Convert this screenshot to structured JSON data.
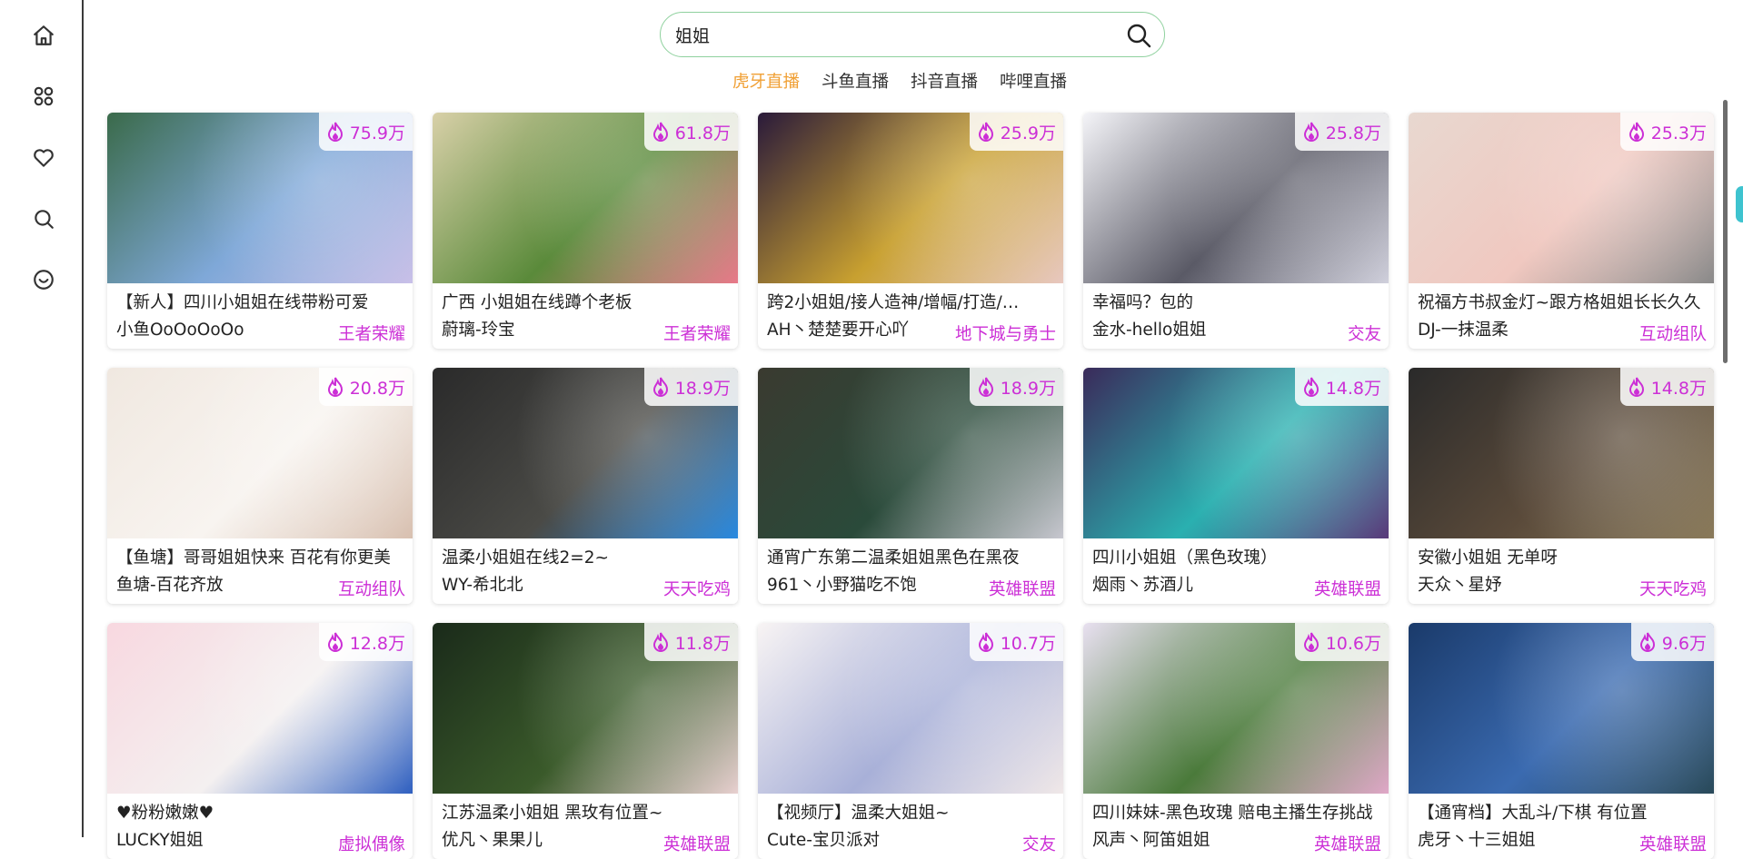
{
  "sidebar": {
    "items": [
      {
        "name": "home-icon"
      },
      {
        "name": "category-icon"
      },
      {
        "name": "heart-icon"
      },
      {
        "name": "search-icon"
      },
      {
        "name": "smile-icon"
      }
    ]
  },
  "search": {
    "value": "姐姐",
    "placeholder": ""
  },
  "tabs": [
    "虎牙直播",
    "斗鱼直播",
    "抖音直播",
    "哔哩直播"
  ],
  "active_tab": 0,
  "colors": {
    "accent": "#f0a035",
    "badge": "#cc2fd6",
    "search_border": "#8fd19e"
  },
  "rooms": [
    {
      "heat": "75.9万",
      "category": "王者荣耀",
      "title": "【新人】四川小姐姐在线带粉可爱",
      "anchor": "小鱼OoOoOoOo",
      "colors": [
        "#3a6a4a",
        "#7fa8d8",
        "#c9c0e8"
      ]
    },
    {
      "heat": "61.8万",
      "category": "王者荣耀",
      "title": "广西 小姐姐在线蹲个老板",
      "anchor": "蔚璃-玲宝",
      "colors": [
        "#d8d0a8",
        "#5a8a3a",
        "#e87a8a"
      ]
    },
    {
      "heat": "25.9万",
      "category": "地下城与勇士",
      "title": "跨2小姐姐/接人造神/增幅/打造/…",
      "anchor": "AH丶楚楚要开心吖",
      "colors": [
        "#2a1a3a",
        "#c8a030",
        "#e8c8c0"
      ]
    },
    {
      "heat": "25.8万",
      "category": "交友",
      "title": "幸福吗？包的",
      "anchor": "金水-hello姐姐",
      "colors": [
        "#f4f4f8",
        "#5a5a66",
        "#d0d0dc"
      ]
    },
    {
      "heat": "25.3万",
      "category": "互动组队",
      "title": "祝福方书叔金灯~跟方格姐姐长长久久",
      "anchor": "DJ-一抹温柔",
      "colors": [
        "#e8d8d0",
        "#f0c8c0",
        "#8a8a8a"
      ]
    },
    {
      "heat": "20.8万",
      "category": "互动组队",
      "title": "【鱼塘】哥哥姐姐快来 百花有你更美",
      "anchor": "鱼塘-百花齐放",
      "colors": [
        "#f0e8e0",
        "#f8f4f0",
        "#d8c0b0"
      ]
    },
    {
      "heat": "18.9万",
      "category": "天天吃鸡",
      "title": "温柔小姐姐在线2=2~",
      "anchor": "WY-希北北",
      "colors": [
        "#2a2a2a",
        "#4a4a46",
        "#2a8ae0"
      ]
    },
    {
      "heat": "18.9万",
      "category": "英雄联盟",
      "title": "通宵广东第二温柔姐姐黑色在黑夜",
      "anchor": "961丶小野猫吃不饱",
      "colors": [
        "#3a3a30",
        "#2a4a3a",
        "#c8c8d0"
      ]
    },
    {
      "heat": "14.8万",
      "category": "英雄联盟",
      "title": "四川小姐姐（黑色玫瑰）",
      "anchor": "烟雨丶苏酒儿",
      "colors": [
        "#3a2a5a",
        "#2ab0b0",
        "#5a3a7a"
      ]
    },
    {
      "heat": "14.8万",
      "category": "天天吃鸡",
      "title": "安徽小姐姐 无单呀",
      "anchor": "天众丶星妤",
      "colors": [
        "#2a2a2a",
        "#5a4a3a",
        "#8a7a5a"
      ]
    },
    {
      "heat": "12.8万",
      "category": "虚拟偶像",
      "title": "♥粉粉嫩嫩♥",
      "anchor": "LUCKY姐姐",
      "colors": [
        "#f8d8e0",
        "#f4f0f0",
        "#3060c0"
      ]
    },
    {
      "heat": "11.8万",
      "category": "英雄联盟",
      "title": "江苏温柔小姐姐 黑玫有位置~",
      "anchor": "优凡丶果果儿",
      "colors": [
        "#1a2a1a",
        "#3a5a2a",
        "#e8d0d0"
      ]
    },
    {
      "heat": "10.7万",
      "category": "交友",
      "title": "【视频厅】温柔大姐姐~",
      "anchor": "Cute-宝贝派对",
      "colors": [
        "#f8f4f4",
        "#a8b0d8",
        "#f0e8e8"
      ]
    },
    {
      "heat": "10.6万",
      "category": "英雄联盟",
      "title": "四川妹妹-黑色玫瑰 赔电主播生存挑战",
      "anchor": "风声丶阿笛姐姐",
      "colors": [
        "#e8e0f0",
        "#4a7a3a",
        "#e0a8c8"
      ]
    },
    {
      "heat": "9.6万",
      "category": "英雄联盟",
      "title": "【通宵档】大乱斗/下棋 有位置",
      "anchor": "虎牙丶十三姐姐",
      "colors": [
        "#1a3a6a",
        "#3a6ab0",
        "#2a4a5a"
      ]
    }
  ]
}
